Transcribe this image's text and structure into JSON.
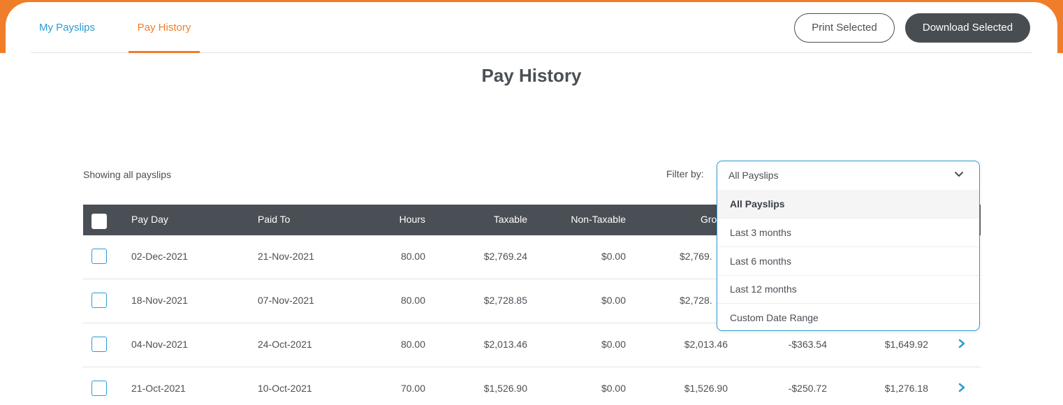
{
  "tabs": [
    {
      "label": "My Payslips"
    },
    {
      "label": "Pay History"
    }
  ],
  "actions": {
    "print_label": "Print Selected",
    "download_label": "Download Selected"
  },
  "page": {
    "title": "Pay History",
    "showing_text": "Showing all payslips"
  },
  "filter": {
    "label": "Filter by:",
    "selected": "All Payslips",
    "options": [
      "All Payslips",
      "Last 3 months",
      "Last 6 months",
      "Last 12 months",
      "Custom Date Range"
    ]
  },
  "table": {
    "columns": [
      "Pay Day",
      "Paid To",
      "Hours",
      "Taxable",
      "Non-Taxable",
      "Gro"
    ],
    "rows": [
      {
        "pay_day": "02-Dec-2021",
        "paid_to": "21-Nov-2021",
        "hours": "80.00",
        "taxable": "$2,769.24",
        "non_taxable": "$0.00",
        "gross": "$2,769.",
        "deductions": "",
        "net": ""
      },
      {
        "pay_day": "18-Nov-2021",
        "paid_to": "07-Nov-2021",
        "hours": "80.00",
        "taxable": "$2,728.85",
        "non_taxable": "$0.00",
        "gross": "$2,728.",
        "deductions": "",
        "net": ""
      },
      {
        "pay_day": "04-Nov-2021",
        "paid_to": "24-Oct-2021",
        "hours": "80.00",
        "taxable": "$2,013.46",
        "non_taxable": "$0.00",
        "gross": "$2,013.46",
        "deductions": "-$363.54",
        "net": "$1,649.92"
      },
      {
        "pay_day": "21-Oct-2021",
        "paid_to": "10-Oct-2021",
        "hours": "70.00",
        "taxable": "$1,526.90",
        "non_taxable": "$0.00",
        "gross": "$1,526.90",
        "deductions": "-$250.72",
        "net": "$1,276.18"
      }
    ]
  },
  "colors": {
    "accent_orange": "#f07d2a",
    "link_blue": "#2b9bd3",
    "dark_gray": "#4a4f55"
  }
}
